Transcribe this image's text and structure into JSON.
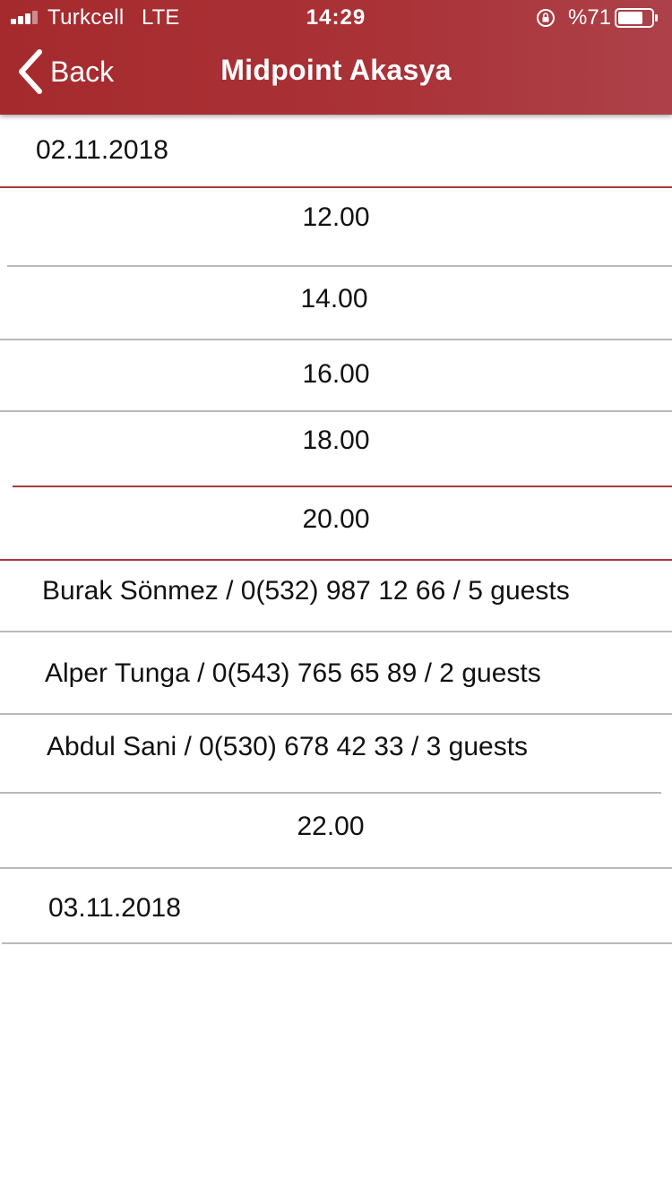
{
  "status_bar": {
    "carrier": "Turkcell",
    "network": "LTE",
    "time": "14:29",
    "battery_percent": "%71",
    "icons": [
      "signal-icon",
      "orientation-lock-icon",
      "battery-icon"
    ]
  },
  "nav": {
    "back_label": "Back",
    "title": "Midpoint Akasya",
    "icons": [
      "back-chevron-icon"
    ]
  },
  "colors": {
    "header_background": "#a82f33",
    "header_text": "#ffffff",
    "date_divider": "#a83a3e",
    "row_divider": "#b9b9b9",
    "text": "#111111",
    "background": "#ffffff"
  },
  "list": {
    "date_1": "02.11.2018",
    "times": [
      "12.00",
      "14.00",
      "16.00",
      "18.00",
      "20.00"
    ],
    "reservations": [
      {
        "name": "Burak Sönmez",
        "phone": "0(532) 987 12 66",
        "guests": "5 guests",
        "text": "Burak Sönmez / 0(532) 987 12 66 / 5 guests"
      },
      {
        "name": "Alper Tunga",
        "phone": "0(543) 765 65 89",
        "guests": "2 guests",
        "text": "Alper Tunga / 0(543) 765 65 89 / 2 guests"
      },
      {
        "name": "Abdul Sani",
        "phone": "0(530) 678 42 33",
        "guests": "3 guests",
        "text": "Abdul Sani / 0(530) 678 42 33 / 3 guests"
      }
    ],
    "time_after": "22.00",
    "date_2": "03.11.2018"
  }
}
